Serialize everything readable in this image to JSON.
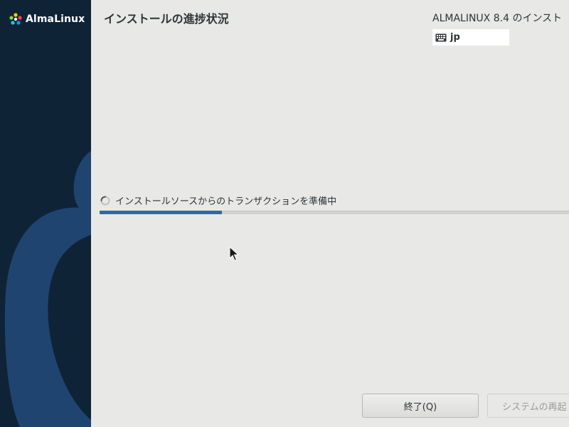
{
  "sidebar": {
    "logo_text": "AlmaLinux"
  },
  "header": {
    "page_title": "インストールの進捗状況",
    "product_title": "ALMALINUX 8.4 のインスト",
    "keyboard_layout": "jp"
  },
  "progress": {
    "status_text": "インストールソースからのトランザクションを準備中",
    "fraction": 0.26
  },
  "buttons": {
    "quit_label": "終了(Q)",
    "reboot_label": "システムの再起"
  },
  "colors": {
    "sidebar_bg": "#0f2337",
    "sidebar_shape": "#1f4470",
    "progress_fill": "#3465a4",
    "main_bg": "#e8e8e7"
  },
  "icons": {
    "logo": "almalinux-logo-icon",
    "keyboard": "keyboard-icon",
    "spinner": "spinner-icon",
    "cursor": "mouse-pointer-icon"
  }
}
